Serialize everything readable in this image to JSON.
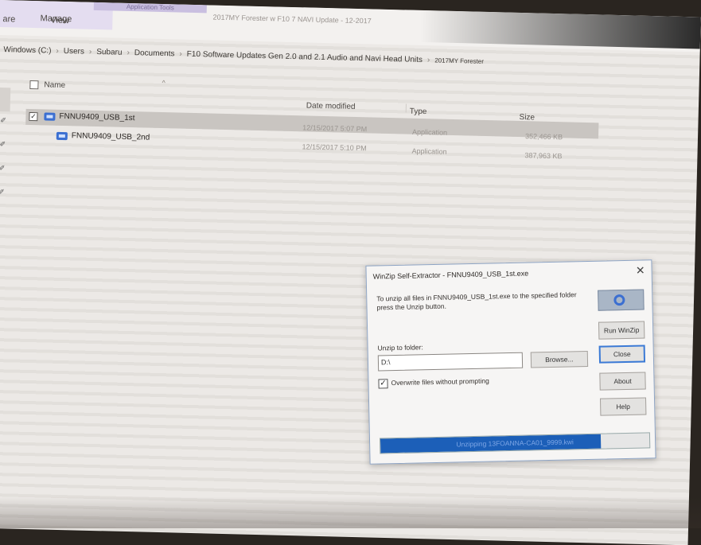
{
  "ribbon": {
    "tab_share": "are",
    "tab_view": "View",
    "tab_manage": "Manage",
    "tab_manage_context": "Application Tools",
    "window_title": "2017MY Forester w F10 7 NAVI Update - 12-2017"
  },
  "breadcrumb": [
    "Windows (C:)",
    "Users",
    "Subaru",
    "Documents",
    "F10 Software Updates Gen 2.0 and 2.1 Audio and Navi Head Units",
    "2017MY Forester"
  ],
  "columns": {
    "name": "Name",
    "date": "Date modified",
    "type": "Type",
    "size": "Size"
  },
  "files": [
    {
      "name": "FNNU9409_USB_1st",
      "date": "12/15/2017 5:07 PM",
      "type": "Application",
      "size": "352,466 KB",
      "selected": true
    },
    {
      "name": "FNNU9409_USB_2nd",
      "date": "12/15/2017 5:10 PM",
      "type": "Application",
      "size": "387,963 KB",
      "selected": false
    }
  ],
  "dialog": {
    "title": "WinZip Self-Extractor - FNNU9409_USB_1st.exe",
    "close_glyph": "✕",
    "message": "To unzip all files in FNNU9409_USB_1st.exe to the specified folder press the Unzip button.",
    "unzip_to_label": "Unzip to folder:",
    "folder_value": "D:\\",
    "browse_label": "Browse...",
    "overwrite_label": "Overwrite files without prompting",
    "overwrite_checked": true,
    "buttons": {
      "run_winzip": "Run WinZip",
      "close": "Close",
      "about": "About",
      "help": "Help"
    },
    "progress_text": "Unzipping 13FOANNA-CA01_9999.kwi",
    "progress_fraction": 0.82
  },
  "colors": {
    "accent": "#3b7ad6",
    "progress": "#1c5fb8",
    "selection": "#c9c5c1"
  }
}
